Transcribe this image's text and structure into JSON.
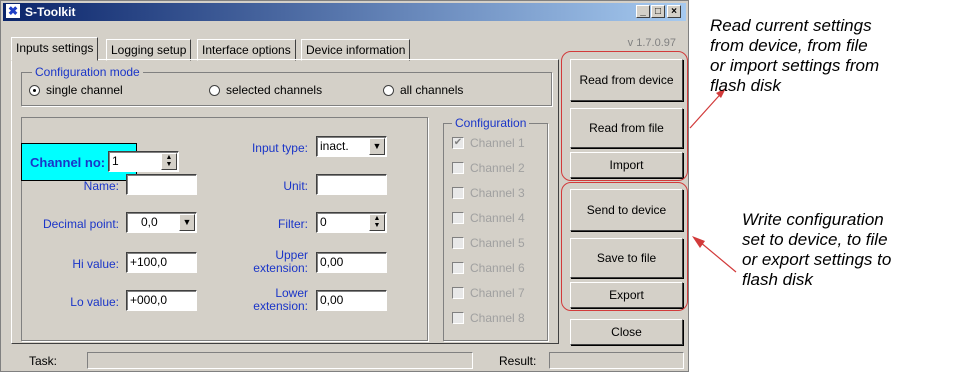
{
  "window": {
    "title": "S-Toolkit",
    "version": "v 1.7.0.97",
    "controls": {
      "minimize": "_",
      "maximize": "□",
      "close": "×"
    }
  },
  "tabs": [
    {
      "label": "Inputs settings",
      "active": true
    },
    {
      "label": "Logging setup",
      "active": false
    },
    {
      "label": "Interface options",
      "active": false
    },
    {
      "label": "Device information",
      "active": false
    }
  ],
  "config_mode": {
    "label": "Configuration mode",
    "options": [
      {
        "label": "single channel",
        "selected": true
      },
      {
        "label": "selected channels",
        "selected": false
      },
      {
        "label": "all channels",
        "selected": false
      }
    ]
  },
  "form": {
    "channel_no_label": "Channel no:",
    "channel_no_value": "1",
    "name_label": "Name:",
    "name_value": "",
    "decimal_point_label": "Decimal point:",
    "decimal_point_value": "0,0",
    "hi_value_label": "Hi value:",
    "hi_value_value": "+100,0",
    "lo_value_label": "Lo value:",
    "lo_value_value": "+000,0",
    "input_type_label": "Input type:",
    "input_type_value": "inact.",
    "unit_label": "Unit:",
    "unit_value": "",
    "filter_label": "Filter:",
    "filter_value": "0",
    "upper_ext_label_1": "Upper",
    "upper_ext_label_2": "extension:",
    "upper_ext_value": "0,00",
    "lower_ext_label_1": "Lower",
    "lower_ext_label_2": "extension:",
    "lower_ext_value": "0,00"
  },
  "configuration": {
    "label": "Configuration",
    "channels": [
      {
        "label": "Channel 1",
        "checked": true
      },
      {
        "label": "Channel 2",
        "checked": false
      },
      {
        "label": "Channel 3",
        "checked": false
      },
      {
        "label": "Channel 4",
        "checked": false
      },
      {
        "label": "Channel 5",
        "checked": false
      },
      {
        "label": "Channel 6",
        "checked": false
      },
      {
        "label": "Channel 7",
        "checked": false
      },
      {
        "label": "Channel 8",
        "checked": false
      }
    ]
  },
  "buttons": {
    "read_from_device": "Read from device",
    "read_from_file": "Read from file",
    "import": "Import",
    "send_to_device": "Send to device",
    "save_to_file": "Save to file",
    "export": "Export",
    "close": "Close"
  },
  "status": {
    "task_label": "Task:",
    "result_label": "Result:"
  },
  "annotations": {
    "read_line_1": "Read current settings",
    "read_line_2": "from device, from file",
    "read_line_3": "or import settings from",
    "read_line_4": "flash disk",
    "write_line_1": "Write configuration",
    "write_line_2": "set to device, to file",
    "write_line_3": "or export settings to",
    "write_line_4": "flash disk"
  },
  "colors": {
    "title_bar": "#0a246a",
    "label_blue": "#1a35c8",
    "channel_box": "#00ffff",
    "highlight": "#d23a3a",
    "window_bg": "#d4d0c8"
  }
}
